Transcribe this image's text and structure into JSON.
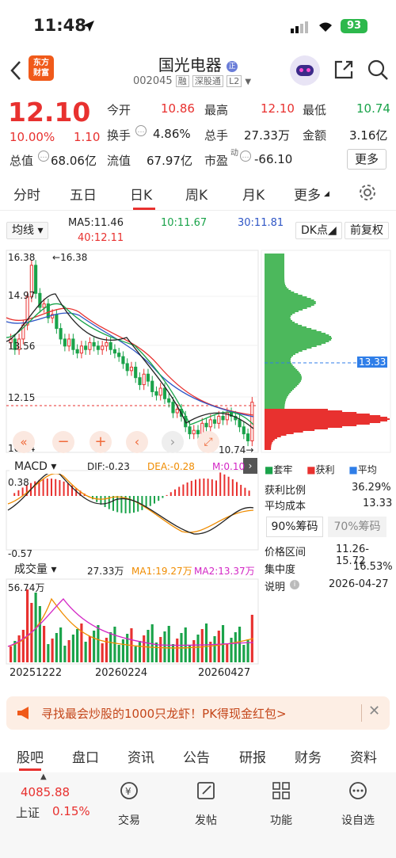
{
  "status": {
    "time": "11:48",
    "battery": "93"
  },
  "header": {
    "logo_line1": "东方",
    "logo_line2": "财富",
    "name": "国光电器",
    "code": "002045",
    "badge_rong": "融",
    "badge_sgt": "深股通",
    "badge_l2": "L2"
  },
  "quote": {
    "price": "12.10",
    "pct": "10.00%",
    "change": "1.10",
    "open_label": "今开",
    "open": "10.86",
    "high_label": "最高",
    "high": "12.10",
    "low_label": "最低",
    "low": "10.74",
    "turnover_label": "换手",
    "turnover": "4.86%",
    "volume_label": "总手",
    "volume": "27.33万",
    "amount_label": "金额",
    "amount": "3.16亿",
    "mcap_label": "总值",
    "mcap": "68.06亿",
    "float_label": "流值",
    "float": "67.97亿",
    "pe_label": "市盈",
    "pe_sup": "动",
    "pe": "-66.10",
    "more": "更多"
  },
  "tabs": [
    "分时",
    "五日",
    "日K",
    "周K",
    "月K",
    "更多"
  ],
  "tab_active": 2,
  "kline": {
    "indicator": "均线",
    "ma5": "MA5:11.46",
    "ma10": "10:11.67",
    "ma30": "30:11.81",
    "ma40": "40:12.11",
    "dk": "DK点",
    "fq": "前复权",
    "y_labels": [
      "16.38",
      "14.97",
      "13.56",
      "12.15",
      "10.74"
    ],
    "high_mark": "16.38",
    "low_mark": "10.74"
  },
  "chips": {
    "price_marker": "13.33",
    "legend": [
      "套牢",
      "获利",
      "平均"
    ],
    "rows": [
      {
        "label": "获利比例",
        "value": "36.29%"
      },
      {
        "label": "平均成本",
        "value": "13.33"
      }
    ],
    "btn90": "90%筹码",
    "btn70": "70%筹码",
    "rows2": [
      {
        "label": "价格区间",
        "value": "11.26-15.72"
      },
      {
        "label": "集中度",
        "value": "16.53%"
      },
      {
        "label": "说明",
        "value": "2026-04-27"
      }
    ]
  },
  "macd": {
    "name": "MACD",
    "dif": "DIF:-0.23",
    "dea": "DEA:-0.28",
    "m": "M:0.10",
    "top": "0.38",
    "bottom": "-0.57"
  },
  "vol": {
    "name": "成交量",
    "v": "27.33万",
    "ma1": "MA1:19.27万",
    "ma2": "MA2:13.37万",
    "top": "56.74万"
  },
  "dates": [
    "20251222",
    "20260224",
    "20260427"
  ],
  "banner": {
    "text": "寻找最会炒股的1000只龙虾！PK得现金红包>"
  },
  "bottom_tabs": [
    "股吧",
    "盘口",
    "资讯",
    "公告",
    "研报",
    "财务",
    "资料"
  ],
  "footer": {
    "index_value": "4085.88",
    "index_name": "上证",
    "index_pct": "0.15%",
    "items": [
      "交易",
      "发帖",
      "功能",
      "设自选"
    ]
  },
  "colors": {
    "up": "#e8312f",
    "down": "#1aa34a",
    "accent": "#e8312f"
  },
  "chart_data": {
    "type": "candlestick",
    "closes": [
      13.9,
      13.6,
      13.9,
      14.3,
      15.1,
      16.0,
      15.2,
      14.8,
      14.9,
      14.5,
      14.6,
      14.2,
      13.9,
      13.7,
      13.9,
      13.6,
      13.5,
      13.7,
      13.6,
      13.8,
      13.7,
      13.6,
      13.7,
      13.8,
      13.6,
      13.5,
      13.4,
      13.2,
      13.0,
      13.1,
      12.8,
      12.6,
      12.9,
      12.7,
      12.4,
      12.3,
      12.5,
      12.2,
      12.1,
      11.8,
      11.9,
      11.7,
      11.4,
      11.2,
      11.3,
      11.2,
      11.5,
      11.4,
      11.6,
      11.5,
      11.7,
      11.6,
      11.8,
      11.7,
      11.6,
      11.4,
      11.2,
      11.0,
      12.1
    ],
    "ylim": [
      10.74,
      16.38
    ]
  }
}
